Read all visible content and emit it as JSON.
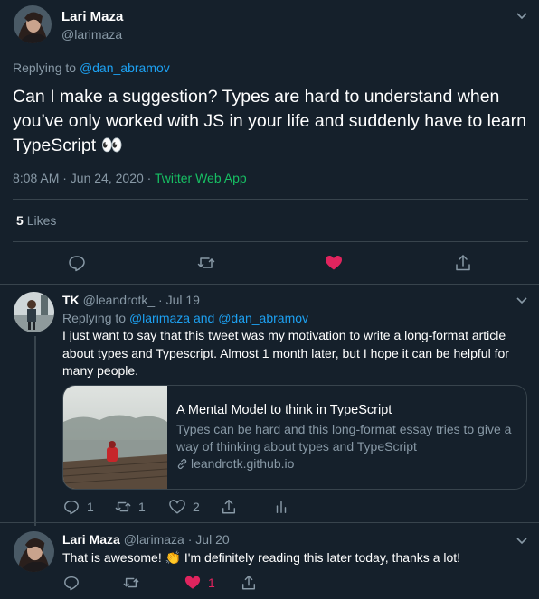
{
  "main_tweet": {
    "name": "Lari Maza",
    "handle": "@larimaza",
    "replying_label": "Replying to",
    "replying_to": "@dan_abramov",
    "text": "Can I make a suggestion? Types are hard to understand when you’ve only worked with JS in your life and suddenly have to learn TypeScript 👀",
    "time": "8:08 AM · Jun 24, 2020",
    "dot": "·",
    "source": "Twitter Web App",
    "likes_count": "5",
    "likes_label": "Likes"
  },
  "reply_tk": {
    "name": "TK",
    "handle": "@leandrotk_",
    "dot": "·",
    "date": "Jul 19",
    "replying_label": "Replying to",
    "replying_to_1": "@larimaza",
    "and_label": "and",
    "replying_to_2": "@dan_abramov",
    "text": "I just want to say that this tweet was my motivation to write a long-format article about types and Typescript. Almost 1 month later, but I hope it can be helpful for many people.",
    "card": {
      "title": "A Mental Model to think in TypeScript",
      "description": "Types can be hard and this long-format essay tries to give a way of thinking about types and TypeScript",
      "domain": "leandrotk.github.io"
    },
    "reply_count": "1",
    "retweet_count": "1",
    "like_count": "2"
  },
  "reply_lari": {
    "name": "Lari Maza",
    "handle": "@larimaza",
    "dot": "·",
    "date": "Jul 20",
    "text": "That is awesome! 👏 I'm definitely reading this later today, thanks a lot!",
    "like_count": "1"
  },
  "colors": {
    "background": "#15202b",
    "accent": "#1da1f2",
    "like": "#e0245e",
    "source": "#17bf63",
    "muted": "#8899a6",
    "border": "#38444d"
  },
  "icons": [
    "chevron-down-icon",
    "reply-icon",
    "retweet-icon",
    "heart-icon",
    "share-icon",
    "analytics-icon",
    "link-icon"
  ]
}
